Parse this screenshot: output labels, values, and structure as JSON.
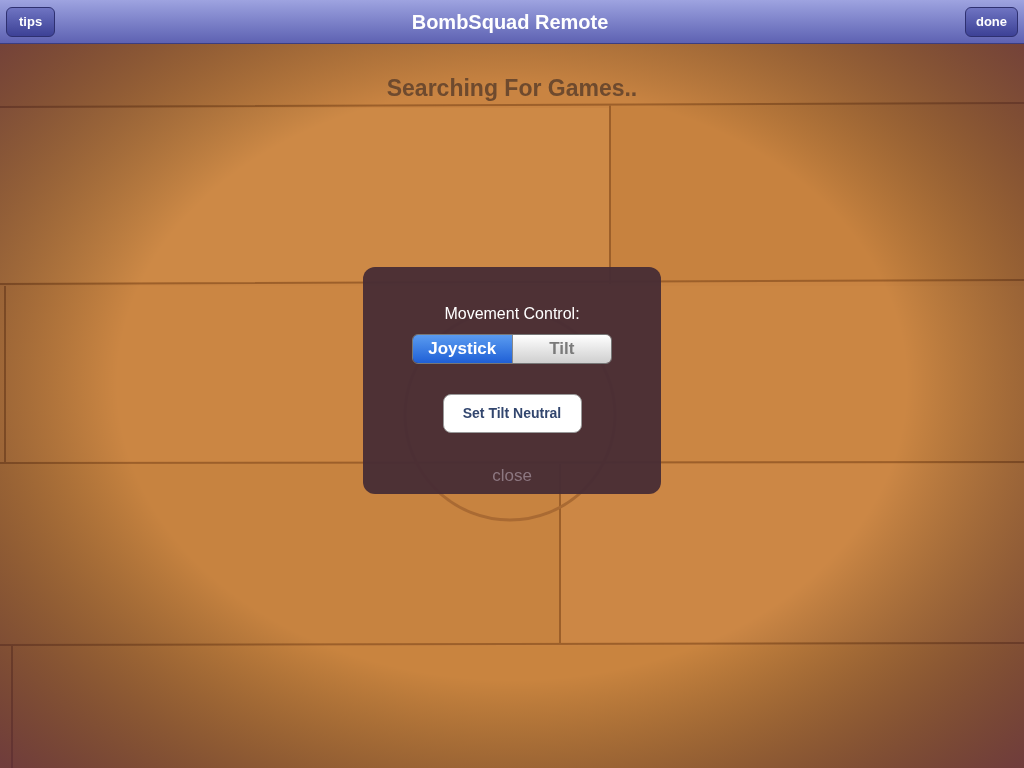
{
  "nav_bar": {
    "left_button": "tips",
    "title": "BombSquad Remote",
    "right_button": "done"
  },
  "status": "Searching For Games..",
  "dialog": {
    "label": "Movement Control:",
    "segments": [
      {
        "label": "Joystick",
        "selected": true
      },
      {
        "label": "Tilt",
        "selected": false
      }
    ],
    "button": "Set Tilt Neutral",
    "close": "close"
  }
}
